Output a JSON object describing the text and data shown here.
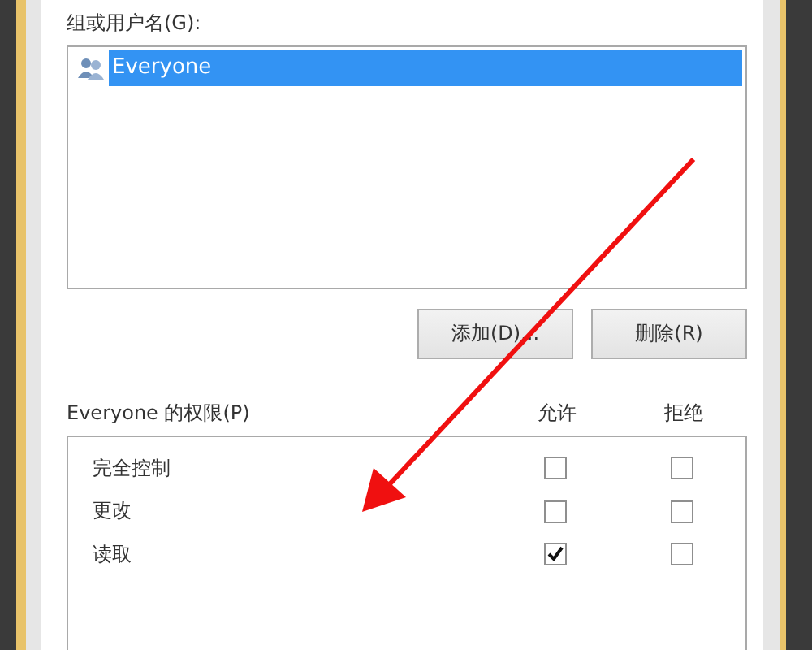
{
  "group_label": "组或用户名(G):",
  "users": [
    {
      "name": "Everyone",
      "selected": true
    }
  ],
  "buttons": [
    "添加(D)...",
    "删除(R)"
  ],
  "permissions_label": "Everyone 的权限(P)",
  "columns": [
    "允许",
    "拒绝"
  ],
  "permissions": [
    {
      "name": "完全控制",
      "allow": false,
      "deny": false
    },
    {
      "name": "更改",
      "allow": false,
      "deny": false
    },
    {
      "name": "读取",
      "allow": true,
      "deny": false
    }
  ]
}
